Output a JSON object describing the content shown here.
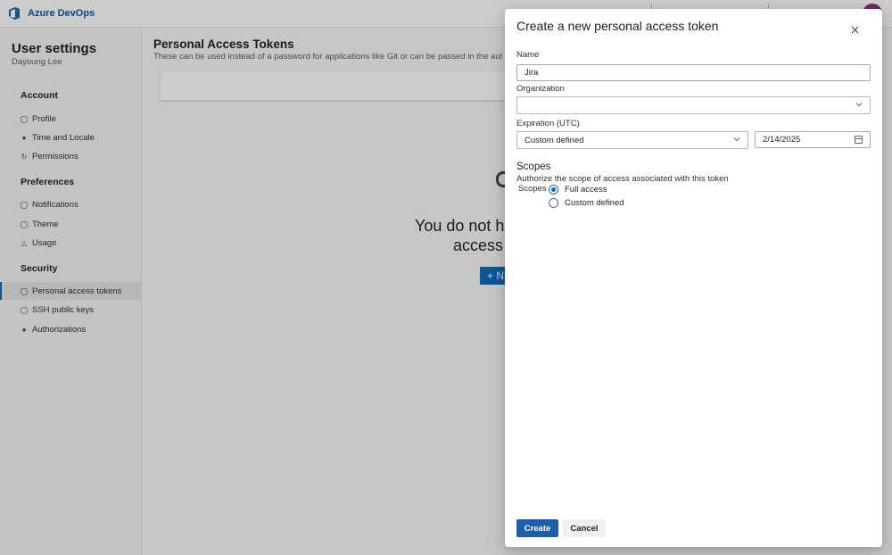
{
  "app": {
    "brand": "Azure DevOps",
    "accent_color": "#0f6cbd",
    "avatar_color": "#8a2e86"
  },
  "sidebar": {
    "title": "User settings",
    "user": "Dayoung Lee",
    "sections": [
      {
        "heading": "Account",
        "items": [
          {
            "label": "Profile",
            "icon": "profile-icon"
          },
          {
            "label": "Time and Locale",
            "icon": "globe-icon"
          },
          {
            "label": "Permissions",
            "icon": "refresh-icon"
          }
        ]
      },
      {
        "heading": "Preferences",
        "items": [
          {
            "label": "Notifications",
            "icon": "chat-icon"
          },
          {
            "label": "Theme",
            "icon": "palette-icon"
          },
          {
            "label": "Usage",
            "icon": "chart-icon"
          }
        ]
      },
      {
        "heading": "Security",
        "items": [
          {
            "label": "Personal access tokens",
            "icon": "key-person-icon",
            "selected": true
          },
          {
            "label": "SSH public keys",
            "icon": "key-icon"
          },
          {
            "label": "Authorizations",
            "icon": "lock-icon"
          }
        ]
      }
    ]
  },
  "main": {
    "title": "Personal Access Tokens",
    "subtitle": "These can be used instead of a password for applications like Git or can be passed in the aut",
    "empty_line1": "You do not ha",
    "empty_line2": "access",
    "new_button": "+ N"
  },
  "panel": {
    "title": "Create a new personal access token",
    "name_label": "Name",
    "name_value": "Jira",
    "org_label": "Organization",
    "org_value": "",
    "expiration_label": "Expiration (UTC)",
    "expiration_value": "Custom defined",
    "date_value": "2/14/2025",
    "scopes_title": "Scopes",
    "scopes_desc": "Authorize the scope of access associated with this token",
    "scopes_radio_label": "Scopes",
    "scope_options": [
      {
        "label": "Full access",
        "checked": true
      },
      {
        "label": "Custom defined",
        "checked": false
      }
    ],
    "create_label": "Create",
    "cancel_label": "Cancel"
  }
}
